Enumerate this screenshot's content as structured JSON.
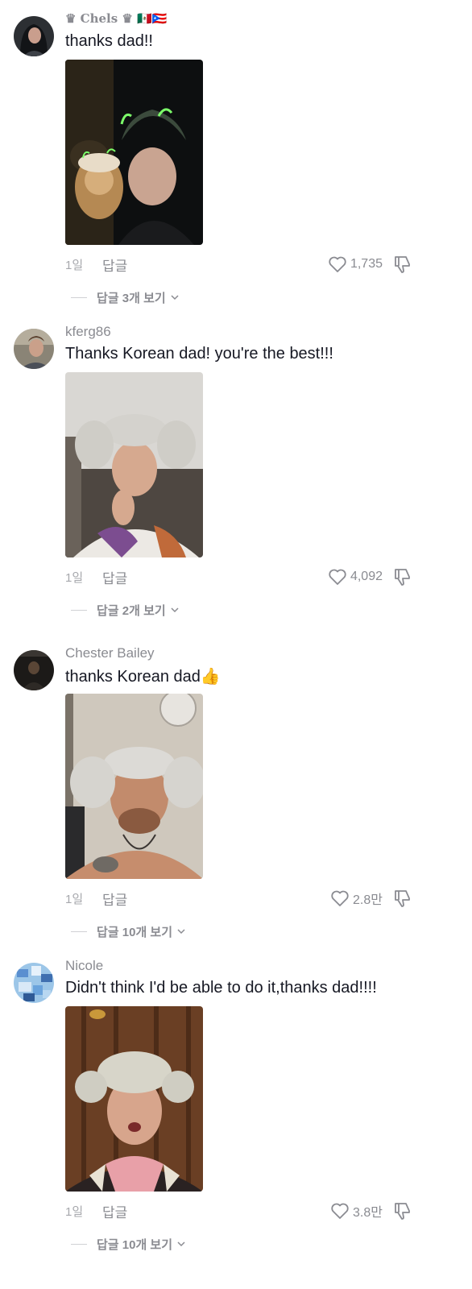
{
  "comments": [
    {
      "username": "♛ Chels ♛ 🇲🇽🇵🇷",
      "text": "thanks dad!!",
      "time": "1일",
      "reply_label": "답글",
      "likes": "1,735",
      "view_replies": "답글 3개 보기"
    },
    {
      "username": "kferg86",
      "text": "Thanks Korean dad! you're the best!!!",
      "time": "1일",
      "reply_label": "답글",
      "likes": "4,092",
      "view_replies": "답글 2개 보기"
    },
    {
      "username": "Chester Bailey",
      "text": "thanks Korean dad👍",
      "time": "1일",
      "reply_label": "답글",
      "likes": "2.8만",
      "view_replies": "답글 10개 보기"
    },
    {
      "username": "Nicole",
      "text": "Didn't think I'd be able to do it,thanks dad!!!!",
      "time": "1일",
      "reply_label": "답글",
      "likes": "3.8만",
      "view_replies": "답글 10개 보기"
    }
  ],
  "icons": {
    "like": "heart-outline-icon",
    "dislike": "thumbs-down-icon",
    "expand": "chevron-down-icon"
  },
  "colors": {
    "text_primary": "#161823",
    "text_secondary": "#8a8b91",
    "text_tertiary": "#a7a8ad"
  }
}
